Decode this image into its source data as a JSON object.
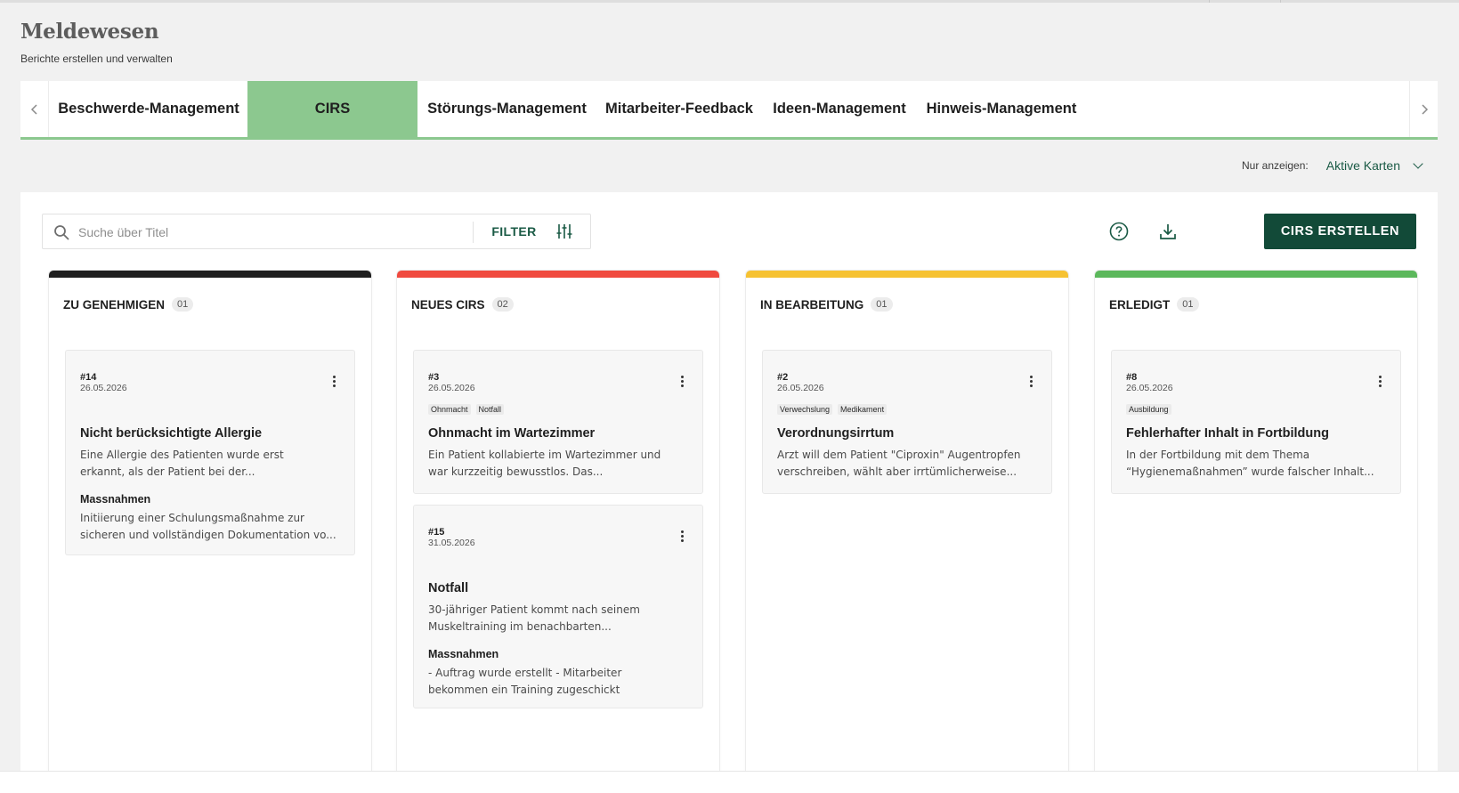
{
  "page": {
    "title": "Meldewesen",
    "subtitle": "Berichte erstellen und verwalten"
  },
  "tabs": {
    "items": [
      {
        "label": "Beschwerde-Management"
      },
      {
        "label": "CIRS"
      },
      {
        "label": "Störungs-Management"
      },
      {
        "label": "Mitarbeiter-Feedback"
      },
      {
        "label": "Ideen-Management"
      },
      {
        "label": "Hinweis-Management"
      }
    ],
    "active": "CIRS"
  },
  "view_filter": {
    "label": "Nur anzeigen:",
    "value": "Aktive Karten"
  },
  "toolbar": {
    "search_placeholder": "Suche über Titel",
    "filter_label": "FILTER",
    "create_label": "CIRS ERSTELLEN"
  },
  "colors": {
    "accent": "#124a38",
    "tab_active": "#8cc88f",
    "status_zu_genehmigen": "#1f1f1f",
    "status_neu": "#f04a3f",
    "status_in_bearbeitung": "#f6c232",
    "status_erledigt": "#5cb85c"
  },
  "columns": [
    {
      "title": "ZU GENEHMIGEN",
      "count": "01",
      "cards": [
        {
          "id": "#14",
          "date": "26.05.2026",
          "title": "Nicht berücksichtigte Allergie",
          "desc_l1": "Eine Allergie des Patienten wurde erst",
          "desc_l2": "erkannt, als der Patient bei der...",
          "measure_label": "Massnahmen",
          "measure_l1": "Initiierung einer Schulungsmaßnahme zur",
          "measure_l2": "sicheren und vollständigen Dokumentation vo..."
        }
      ]
    },
    {
      "title": "NEUES CIRS",
      "count": "02",
      "cards": [
        {
          "id": "#3",
          "date": "26.05.2026",
          "tags": [
            "Ohnmacht",
            "Notfall"
          ],
          "title": "Ohnmacht im Wartezimmer",
          "desc_l1": "Ein Patient kollabierte im Wartezimmer und",
          "desc_l2": "war kurzzeitig bewusstlos. Das..."
        },
        {
          "id": "#15",
          "date": "31.05.2026",
          "title": "Notfall",
          "desc_l1": "30-jähriger Patient kommt nach seinem",
          "desc_l2": "Muskeltraining im benachbarten...",
          "measure_label": "Massnahmen",
          "measure_l1": "- Auftrag wurde erstellt - Mitarbeiter",
          "measure_l2": "bekommen ein Training zugeschickt"
        }
      ]
    },
    {
      "title": "IN BEARBEITUNG",
      "count": "01",
      "cards": [
        {
          "id": "#2",
          "date": "26.05.2026",
          "tags": [
            "Verwechslung",
            "Medikament"
          ],
          "title": "Verordnungsirrtum",
          "desc_l1": "Arzt will dem Patient \"Ciproxin\" Augentropfen",
          "desc_l2": "verschreiben, wählt aber irrtümlicherweise..."
        }
      ]
    },
    {
      "title": "ERLEDIGT",
      "count": "01",
      "cards": [
        {
          "id": "#8",
          "date": "26.05.2026",
          "tags": [
            "Ausbildung"
          ],
          "title": "Fehlerhafter Inhalt in Fortbildung",
          "desc_l1": "In der Fortbildung mit dem Thema",
          "desc_l2": "“Hygienemaßnahmen” wurde falscher Inhalt..."
        }
      ]
    }
  ]
}
